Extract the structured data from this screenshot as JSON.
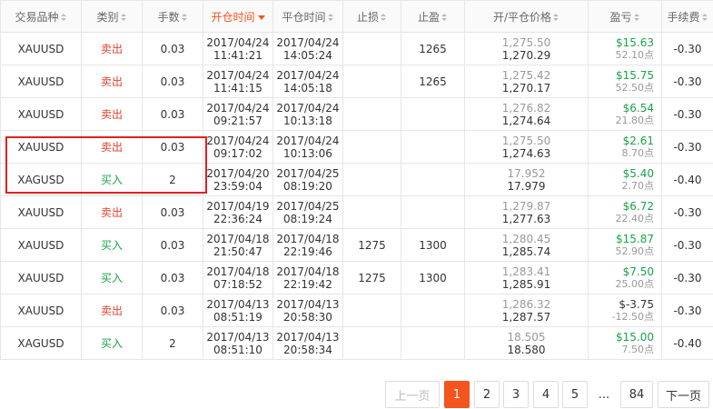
{
  "headers": [
    {
      "label": "交易品种",
      "sort": "both"
    },
    {
      "label": "类别",
      "sort": "both"
    },
    {
      "label": "手数",
      "sort": "both"
    },
    {
      "label": "开仓时间",
      "sort": "desc",
      "active": true
    },
    {
      "label": "平仓时间",
      "sort": "both"
    },
    {
      "label": "止损",
      "sort": "both"
    },
    {
      "label": "止盈",
      "sort": "both"
    },
    {
      "label": "开/平仓价格",
      "sort": "both"
    },
    {
      "label": "盈亏",
      "sort": "both"
    },
    {
      "label": "手续费",
      "sort": "both"
    }
  ],
  "rows": [
    {
      "symbol": "XAUUSD",
      "type": "卖出",
      "side": "sell",
      "lots": "0.03",
      "open_date": "2017/04/24",
      "open_time": "11:41:21",
      "close_date": "2017/04/24",
      "close_time": "14:05:24",
      "sl": "",
      "tp": "1265",
      "open_price": "1,275.50",
      "close_price": "1,270.29",
      "pnl": "$15.63",
      "pnl_color": "#1aa34a",
      "points": "52.10点",
      "fee": "-0.30"
    },
    {
      "symbol": "XAUUSD",
      "type": "卖出",
      "side": "sell",
      "lots": "0.03",
      "open_date": "2017/04/24",
      "open_time": "11:41:15",
      "close_date": "2017/04/24",
      "close_time": "14:05:18",
      "sl": "",
      "tp": "1265",
      "open_price": "1,275.42",
      "close_price": "1,270.17",
      "pnl": "$15.75",
      "pnl_color": "#1aa34a",
      "points": "52.50点",
      "fee": "-0.30"
    },
    {
      "symbol": "XAUUSD",
      "type": "卖出",
      "side": "sell",
      "lots": "0.03",
      "open_date": "2017/04/24",
      "open_time": "09:21:57",
      "close_date": "2017/04/24",
      "close_time": "10:13:18",
      "sl": "",
      "tp": "",
      "open_price": "1,276.82",
      "close_price": "1,274.64",
      "pnl": "$6.54",
      "pnl_color": "#1aa34a",
      "points": "21.80点",
      "fee": "-0.30"
    },
    {
      "symbol": "XAUUSD",
      "type": "卖出",
      "side": "sell",
      "lots": "0.03",
      "open_date": "2017/04/24",
      "open_time": "09:17:02",
      "close_date": "2017/04/24",
      "close_time": "10:13:06",
      "sl": "",
      "tp": "",
      "open_price": "1,275.50",
      "close_price": "1,274.63",
      "pnl": "$2.61",
      "pnl_color": "#1aa34a",
      "points": "8.70点",
      "fee": "-0.30"
    },
    {
      "symbol": "XAGUSD",
      "type": "买入",
      "side": "buy",
      "lots": "2",
      "open_date": "2017/04/20",
      "open_time": "23:59:04",
      "close_date": "2017/04/25",
      "close_time": "08:19:20",
      "sl": "",
      "tp": "",
      "open_price": "17.952",
      "close_price": "17.979",
      "pnl": "$5.40",
      "pnl_color": "#1aa34a",
      "points": "2.70点",
      "fee": "-0.40"
    },
    {
      "symbol": "XAUUSD",
      "type": "卖出",
      "side": "sell",
      "lots": "0.03",
      "open_date": "2017/04/19",
      "open_time": "22:36:24",
      "close_date": "2017/04/25",
      "close_time": "08:19:24",
      "sl": "",
      "tp": "",
      "open_price": "1,279.87",
      "close_price": "1,277.63",
      "pnl": "$6.72",
      "pnl_color": "#1aa34a",
      "points": "22.40点",
      "fee": "-0.30"
    },
    {
      "symbol": "XAUUSD",
      "type": "买入",
      "side": "buy",
      "lots": "0.03",
      "open_date": "2017/04/18",
      "open_time": "21:50:47",
      "close_date": "2017/04/18",
      "close_time": "22:19:46",
      "sl": "1275",
      "tp": "1300",
      "open_price": "1,280.45",
      "close_price": "1,285.74",
      "pnl": "$15.87",
      "pnl_color": "#1aa34a",
      "points": "52.90点",
      "fee": "-0.30"
    },
    {
      "symbol": "XAUUSD",
      "type": "买入",
      "side": "buy",
      "lots": "0.03",
      "open_date": "2017/04/18",
      "open_time": "07:18:52",
      "close_date": "2017/04/18",
      "close_time": "22:19:42",
      "sl": "1275",
      "tp": "1300",
      "open_price": "1,283.41",
      "close_price": "1,285.91",
      "pnl": "$7.50",
      "pnl_color": "#1aa34a",
      "points": "25.00点",
      "fee": "-0.30"
    },
    {
      "symbol": "XAUUSD",
      "type": "卖出",
      "side": "sell",
      "lots": "0.03",
      "open_date": "2017/04/13",
      "open_time": "08:51:19",
      "close_date": "2017/04/13",
      "close_time": "20:58:30",
      "sl": "",
      "tp": "",
      "open_price": "1,286.32",
      "close_price": "1,287.57",
      "pnl": "$-3.75",
      "pnl_color": "#333333",
      "points": "-12.50点",
      "fee": "-0.30"
    },
    {
      "symbol": "XAGUSD",
      "type": "买入",
      "side": "buy",
      "lots": "2",
      "open_date": "2017/04/13",
      "open_time": "08:51:10",
      "close_date": "2017/04/13",
      "close_time": "20:58:34",
      "sl": "",
      "tp": "",
      "open_price": "18.505",
      "close_price": "18.580",
      "pnl": "$15.00",
      "pnl_color": "#1aa34a",
      "points": "7.50点",
      "fee": "-0.40"
    }
  ],
  "pagination": {
    "prev": "上一页",
    "pages": [
      "1",
      "2",
      "3",
      "4",
      "5"
    ],
    "current": "1",
    "ellipsis": "...",
    "last": "84",
    "next": "下一页"
  }
}
